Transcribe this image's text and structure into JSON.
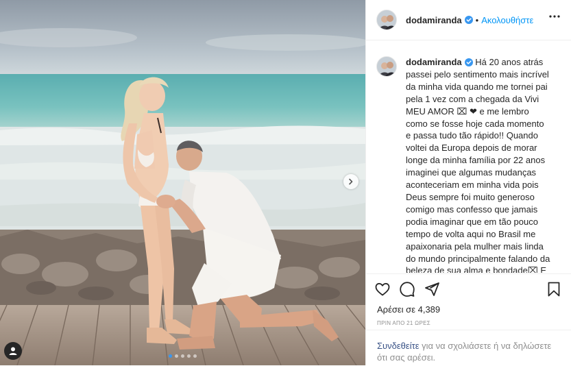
{
  "post": {
    "username": "dodamiranda",
    "follow_label": "Ακολουθήστε",
    "header_separator": "•",
    "caption": "Há 20 anos atrás passei pelo sentimento mais incrível da minha vida quando me tornei pai pela 1 vez com a chegada da Vivi MEU AMOR ⌧ ❤ e me lembro como se fosse hoje cada momento e passa tudo tão rápido!! Quando voltei da Europa depois de morar longe da minha família por 22 anos imaginei que algumas mudanças aconteceriam em minha vida pois Deus sempre foi muito generoso comigo mas confesso que jamais podia imaginar que em tão pouco tempo de volta aqui no Brasil me apaixonaria pela mulher mais linda do mundo principalmente falando da beleza de sua alma e bondade⌧ E que ela se apaixonaria por mim de tal forma que acabaríamos nos casando tão rápido",
    "likes_label": "Αρέσει σε 4,389",
    "time_label": "ΠΡΙΝ ΑΠΟ 21 ΩΡΕΣ",
    "login_link": "Συνδεθείτε",
    "login_text": " για να σχολιάσετε ή να δηλώσετε ότι σας αρέσει.",
    "carousel": {
      "slide_count": 5,
      "current_slide": 1
    },
    "icons": [
      "heart-icon",
      "comment-icon",
      "share-icon",
      "bookmark-icon",
      "more-options-icon",
      "verified-badge-icon",
      "chevron-right-icon",
      "user-tag-icon"
    ],
    "colors": {
      "link": "#0095f6",
      "verified": "#3897f0",
      "muted": "#8e8e8e",
      "text": "#262626",
      "border": "#efefef"
    }
  }
}
